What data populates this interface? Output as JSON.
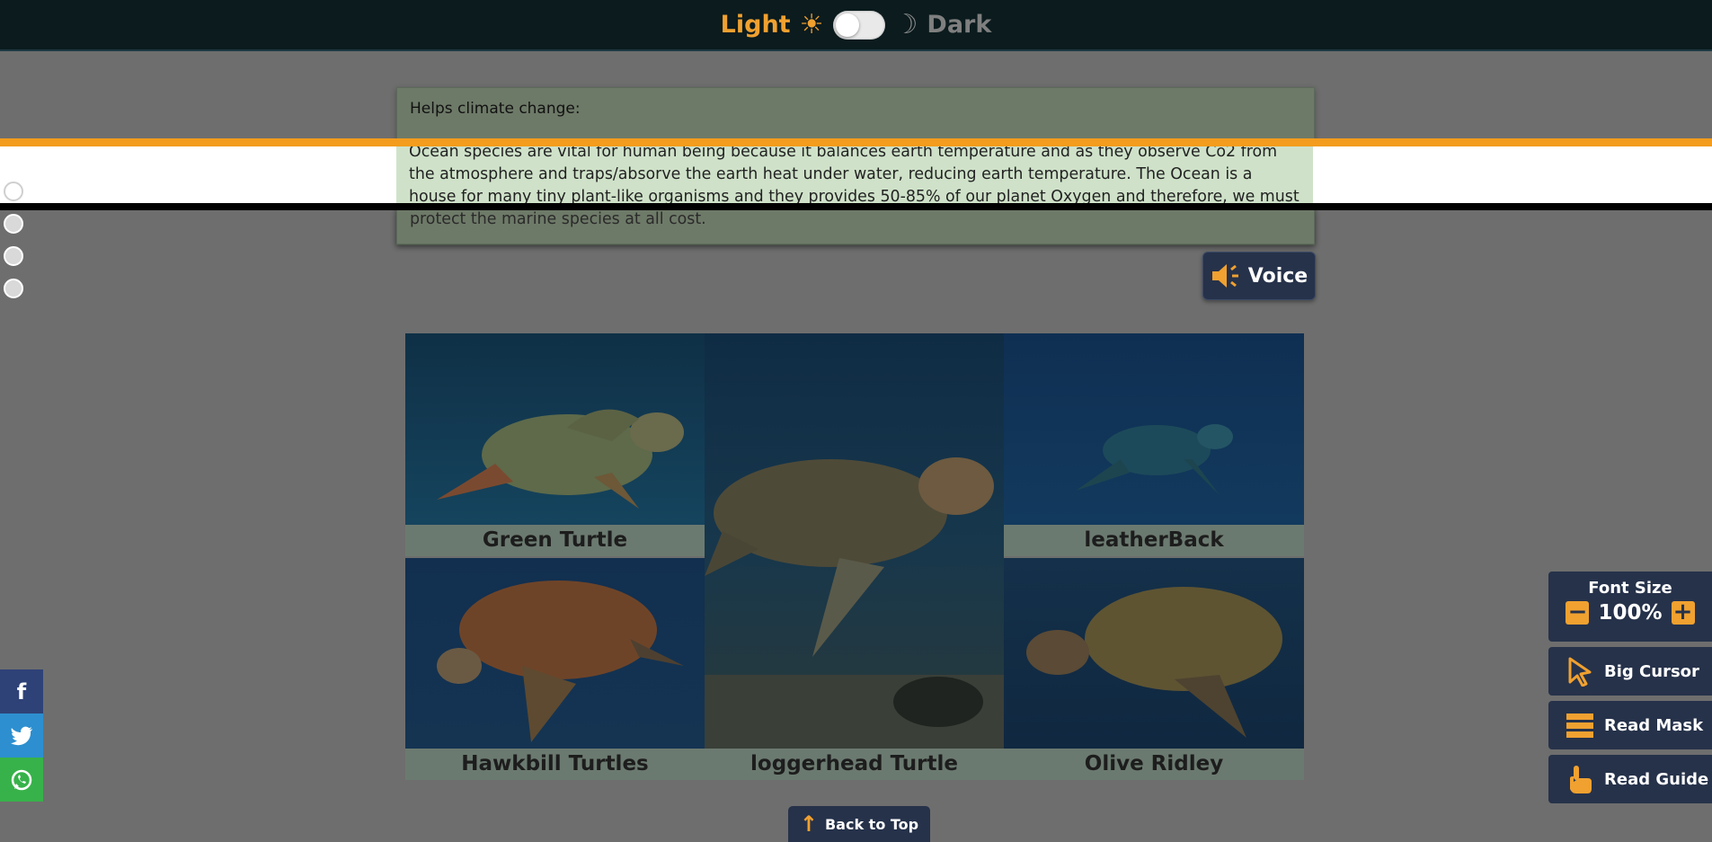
{
  "theme_toggle": {
    "light_label": "Light",
    "dark_label": "Dark"
  },
  "info_card": {
    "heading": "Helps climate change:",
    "body": "Ocean species are vital for human being because it balances earth temperature and as they observe Co2 from the atmosphere and traps/absorve the earth heat under water, reducing earth temperature. The Ocean is a house for many tiny plant-like organisms and they provides 50-85% of our planet Oxygen and therefore, we must protect the marine species at all cost."
  },
  "voice": {
    "label": "Voice"
  },
  "gallery": {
    "tiles": [
      {
        "label": "Green Turtle"
      },
      {
        "label": "loggerhead Turtle"
      },
      {
        "label": "leatherBack"
      },
      {
        "label": "Hawkbill Turtles"
      },
      {
        "label": "Olive Ridley"
      }
    ]
  },
  "back_to_top": {
    "label": "Back to Top"
  },
  "accessibility": {
    "font_size_title": "Font Size",
    "font_size_value": "100%",
    "big_cursor": "Big Cursor",
    "read_mask": "Read Mask",
    "read_guide": "Read Guide"
  },
  "social": {
    "facebook": "f",
    "twitter": "twitter-icon",
    "whatsapp": "whatsapp-icon"
  },
  "colors": {
    "accent": "#f0a130",
    "panel": "#26324a",
    "topbar": "#0b1b1e"
  }
}
